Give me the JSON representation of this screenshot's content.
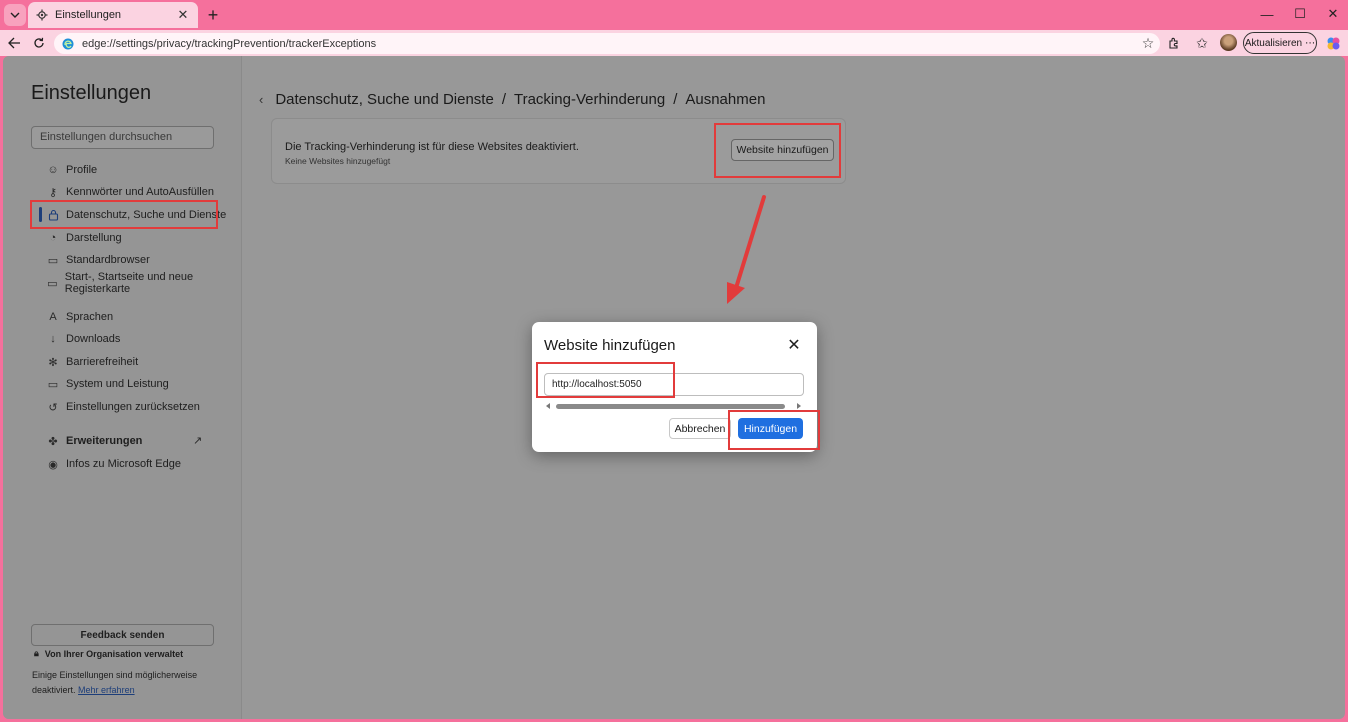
{
  "tab": {
    "title": "Einstellungen"
  },
  "toolbar": {
    "url": "edge://settings/privacy/trackingPrevention/trackerExceptions",
    "update_label": "Aktualisieren"
  },
  "sidebar": {
    "title": "Einstellungen",
    "search_placeholder": "Einstellungen durchsuchen",
    "items": [
      {
        "label": "Profile",
        "icon": "profile-icon"
      },
      {
        "label": "Kennwörter und AutoAusfüllen",
        "icon": "key-icon"
      },
      {
        "label": "Datenschutz, Suche und Dienste",
        "icon": "lock-icon"
      },
      {
        "label": "Darstellung",
        "icon": "palette-icon"
      },
      {
        "label": "Standardbrowser",
        "icon": "browser-icon"
      },
      {
        "label": "Start-, Startseite und neue Registerkarte",
        "icon": "home-icon"
      },
      {
        "label": "Sprachen",
        "icon": "language-icon"
      },
      {
        "label": "Downloads",
        "icon": "download-icon"
      },
      {
        "label": "Barrierefreiheit",
        "icon": "accessibility-icon"
      },
      {
        "label": "System und Leistung",
        "icon": "laptop-icon"
      },
      {
        "label": "Einstellungen zurücksetzen",
        "icon": "reset-icon"
      },
      {
        "label": "Erweiterungen",
        "icon": "extensions-icon"
      },
      {
        "label": "Infos zu Microsoft Edge",
        "icon": "edge-icon"
      }
    ],
    "feedback_label": "Feedback senden",
    "org_label": "Von Ihrer Organisation verwaltet",
    "org_note": "Einige Einstellungen sind möglicherweise deaktiviert.",
    "org_link": "Mehr erfahren"
  },
  "main": {
    "breadcrumb": [
      "Datenschutz, Suche und Dienste",
      "Tracking-Verhinderung",
      "Ausnahmen"
    ],
    "breadcrumb_sep": "/",
    "card_title": "Die Tracking-Verhinderung ist für diese Websites deaktiviert.",
    "card_sub": "Keine Websites hinzugefügt",
    "card_button": "Website hinzufügen"
  },
  "dialog": {
    "title": "Website hinzufügen",
    "input_value": "http://localhost:5050",
    "cancel_label": "Abbrechen",
    "add_label": "Hinzufügen"
  },
  "colors": {
    "accent": "#1f6fe0",
    "highlight": "#e23b3b",
    "browser_frame": "#f5709c"
  }
}
